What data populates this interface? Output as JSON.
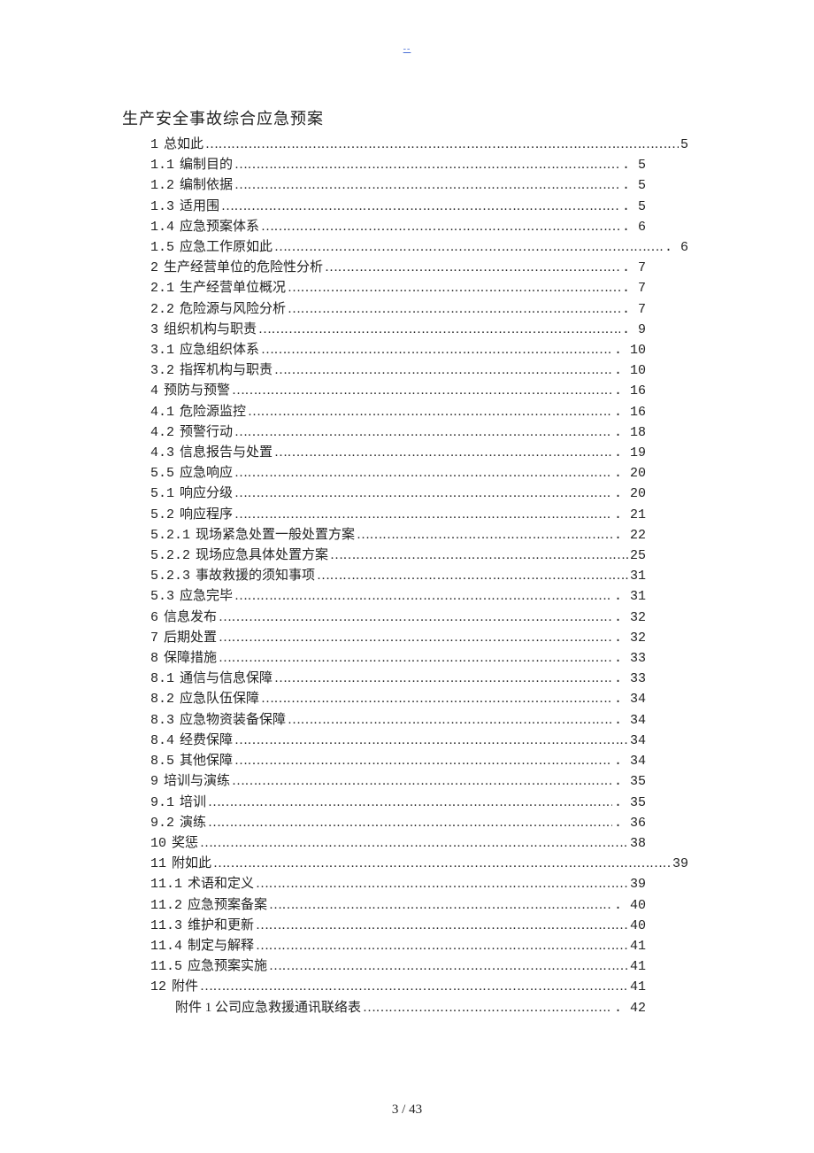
{
  "header_mark": "--",
  "title": "生产安全事故综合应急预案",
  "toc": [
    {
      "num": "1",
      "label": "总如此",
      "page": "5",
      "long": true
    },
    {
      "num": "1.1",
      "label": "编制目的",
      "page": ". 5"
    },
    {
      "num": "1.2",
      "label": "编制依据",
      "page": ". 5"
    },
    {
      "num": "1.3",
      "label": "适用围",
      "page": ". 5"
    },
    {
      "num": "1.4",
      "label": "应急预案体系",
      "page": ". 6"
    },
    {
      "num": "1.5",
      "label": "应急工作原如此",
      "page": ". 6",
      "long": true
    },
    {
      "num": "2",
      "label": "生产经营单位的危险性分析",
      "page": ". 7"
    },
    {
      "num": "2.1",
      "label": "生产经营单位概况",
      "page": ". 7"
    },
    {
      "num": "2.2",
      "label": "危险源与风险分析",
      "page": ". 7"
    },
    {
      "num": "3",
      "label": "组织机构与职责",
      "page": ". 9"
    },
    {
      "num": "3.1",
      "label": "应急组织体系",
      "page": ". 10"
    },
    {
      "num": "3.2",
      "label": "指挥机构与职责",
      "page": ". 10"
    },
    {
      "num": "4",
      "label": "预防与预警",
      "page": ". 16"
    },
    {
      "num": "4.1",
      "label": "危险源监控",
      "page": ". 16"
    },
    {
      "num": "4.2",
      "label": "预警行动",
      "page": ". 18"
    },
    {
      "num": "4.3",
      "label": "信息报告与处置",
      "page": ". 19"
    },
    {
      "num": "5.5",
      "label": "应急响应",
      "page": ". 20"
    },
    {
      "num": "5.1",
      "label": "响应分级",
      "page": ". 20"
    },
    {
      "num": "5.2",
      "label": "响应程序",
      "page": ". 21"
    },
    {
      "num": "5.2.1",
      "label": "现场紧急处置一般处置方案",
      "page": ". 22"
    },
    {
      "num": "5.2.2",
      "label": "现场应急具体处置方案",
      "page": "25"
    },
    {
      "num": "5.2.3",
      "label": "事故救援的须知事项",
      "page": "31"
    },
    {
      "num": "5.3",
      "label": "应急完毕",
      "page": ". 31"
    },
    {
      "num": "6",
      "label": "信息发布",
      "page": ". 32"
    },
    {
      "num": "7",
      "label": "后期处置",
      "page": ". 32"
    },
    {
      "num": "8",
      "label": "保障措施",
      "page": ". 33"
    },
    {
      "num": "8.1",
      "label": "通信与信息保障",
      "page": ". 33"
    },
    {
      "num": "8.2",
      "label": "应急队伍保障",
      "page": ". 34"
    },
    {
      "num": "8.3",
      "label": "应急物资装备保障",
      "page": ". 34"
    },
    {
      "num": "8.4",
      "label": "经费保障",
      "page": "34"
    },
    {
      "num": "8.5",
      "label": "其他保障",
      "page": ". 34"
    },
    {
      "num": "9",
      "label": "培训与演练",
      "page": ". 35"
    },
    {
      "num": "9.1",
      "label": "培训",
      "page": ". 35"
    },
    {
      "num": "9.2",
      "label": "演练",
      "page": ". 36"
    },
    {
      "num": "10",
      "label": "奖惩",
      "page": "38"
    },
    {
      "num": "11",
      "label": "附如此",
      "page": "39",
      "long": true
    },
    {
      "num": "11.1",
      "label": "术语和定义",
      "page": "39"
    },
    {
      "num": "11.2",
      "label": "应急预案备案",
      "page": ". 40"
    },
    {
      "num": "11.3",
      "label": "维护和更新",
      "page": "40"
    },
    {
      "num": "11.4",
      "label": "制定与解释",
      "page": "41"
    },
    {
      "num": "11.5",
      "label": "应急预案实施",
      "page": "41"
    },
    {
      "num": "12",
      "label": "附件",
      "page": "41"
    },
    {
      "num": "",
      "label": "附件 1 公司应急救援通讯联络表",
      "page": ". 42",
      "indent": true
    }
  ],
  "footer": "3 / 43"
}
